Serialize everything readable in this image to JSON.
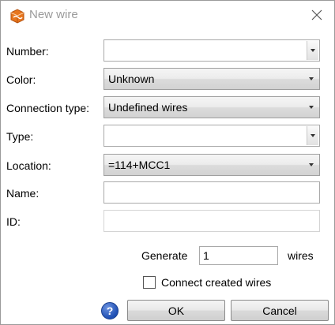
{
  "window": {
    "title": "New wire"
  },
  "form": {
    "number": {
      "label": "Number:",
      "value": ""
    },
    "color": {
      "label": "Color:",
      "value": "Unknown"
    },
    "connection_type": {
      "label": "Connection type:",
      "value": "Undefined wires"
    },
    "type": {
      "label": "Type:",
      "value": ""
    },
    "location": {
      "label": "Location:",
      "value": "=114+MCC1"
    },
    "name": {
      "label": "Name:",
      "value": ""
    },
    "id": {
      "label": "ID:",
      "value": ""
    }
  },
  "generate": {
    "label": "Generate",
    "value": "1",
    "suffix": "wires"
  },
  "connect": {
    "label": "Connect created wires",
    "checked": false
  },
  "buttons": {
    "help": "?",
    "ok": "OK",
    "cancel": "Cancel"
  },
  "icons": {
    "app": "wire-app-icon",
    "close": "close-icon",
    "dropdown": "chevron-down-icon",
    "help": "help-icon"
  },
  "colors": {
    "help_blue": "#1f4fb3",
    "app_orange": "#e8761e"
  }
}
